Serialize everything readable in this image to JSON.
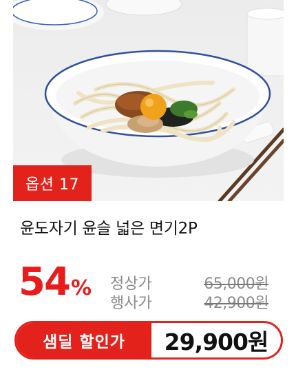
{
  "badge": {
    "option_label": "옵션 17"
  },
  "product": {
    "title": "윤도자기 윤슬 넓은 면기2P"
  },
  "discount": {
    "rate": "54",
    "unit": "%"
  },
  "prices": {
    "regular_label": "정상가",
    "regular_price": "65,000원",
    "event_label": "행사가",
    "event_price": "42,900원"
  },
  "deal": {
    "label": "샘딜 할인가",
    "price": "29,900원"
  },
  "colors": {
    "accent": "#e3221c",
    "discount": "#ea1b1b"
  }
}
